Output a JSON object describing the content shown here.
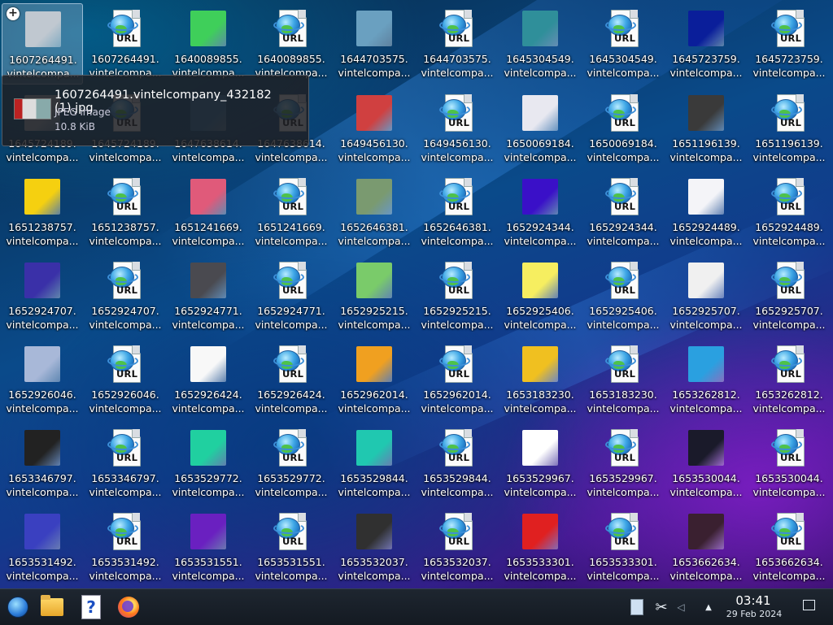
{
  "desktop": {
    "columns_x": [
      0,
      102,
      204,
      306,
      408,
      510,
      612,
      714,
      816,
      918
    ],
    "rows_y": [
      0,
      104,
      207,
      310,
      413,
      516,
      619
    ],
    "icons": [
      {
        "l1": "1607264491.",
        "l2": "vintelcompa...",
        "kind": "thumb",
        "color": "#c0c8d0",
        "sel": true
      },
      {
        "l1": "1607264491.",
        "l2": "vintelcompa...",
        "kind": "url"
      },
      {
        "l1": "1640089855.",
        "l2": "vintelcompa...",
        "kind": "thumb",
        "color": "#3fcf5a"
      },
      {
        "l1": "1640089855.",
        "l2": "vintelcompa...",
        "kind": "url"
      },
      {
        "l1": "1644703575.",
        "l2": "vintelcompa...",
        "kind": "thumb",
        "color": "#6aa0c0"
      },
      {
        "l1": "1644703575.",
        "l2": "vintelcompa...",
        "kind": "url"
      },
      {
        "l1": "1645304549.",
        "l2": "vintelcompa...",
        "kind": "thumb",
        "color": "#2f8f9a"
      },
      {
        "l1": "1645304549.",
        "l2": "vintelcompa...",
        "kind": "url"
      },
      {
        "l1": "1645723759.",
        "l2": "vintelcompa...",
        "kind": "thumb",
        "color": "#0a1e9a"
      },
      {
        "l1": "1645723759.",
        "l2": "vintelcompa...",
        "kind": "url"
      },
      {
        "l1": "1645724189.",
        "l2": "vintelcompa...",
        "kind": "thumb",
        "color": "#b0b8c0"
      },
      {
        "l1": "1645724189.",
        "l2": "vintelcompa...",
        "kind": "url"
      },
      {
        "l1": "1647638614.",
        "l2": "vintelcompa...",
        "kind": "thumb",
        "color": "#2a7ab0"
      },
      {
        "l1": "1647638614.",
        "l2": "vintelcompa...",
        "kind": "url"
      },
      {
        "l1": "1649456130.",
        "l2": "vintelcompa...",
        "kind": "thumb",
        "color": "#d04040"
      },
      {
        "l1": "1649456130.",
        "l2": "vintelcompa...",
        "kind": "url"
      },
      {
        "l1": "1650069184.",
        "l2": "vintelcompa...",
        "kind": "thumb",
        "color": "#e8e8f0"
      },
      {
        "l1": "1650069184.",
        "l2": "vintelcompa...",
        "kind": "url"
      },
      {
        "l1": "1651196139.",
        "l2": "vintelcompa...",
        "kind": "thumb",
        "color": "#3a3a3a"
      },
      {
        "l1": "1651196139.",
        "l2": "vintelcompa...",
        "kind": "url"
      },
      {
        "l1": "1651238757.",
        "l2": "vintelcompa...",
        "kind": "thumb",
        "color": "#f5d010"
      },
      {
        "l1": "1651238757.",
        "l2": "vintelcompa...",
        "kind": "url"
      },
      {
        "l1": "1651241669.",
        "l2": "vintelcompa...",
        "kind": "thumb",
        "color": "#e05a7a"
      },
      {
        "l1": "1651241669.",
        "l2": "vintelcompa...",
        "kind": "url"
      },
      {
        "l1": "1652646381.",
        "l2": "vintelcompa...",
        "kind": "thumb",
        "color": "#7a9a70"
      },
      {
        "l1": "1652646381.",
        "l2": "vintelcompa...",
        "kind": "url"
      },
      {
        "l1": "1652924344.",
        "l2": "vintelcompa...",
        "kind": "thumb",
        "color": "#3a10c8"
      },
      {
        "l1": "1652924344.",
        "l2": "vintelcompa...",
        "kind": "url"
      },
      {
        "l1": "1652924489.",
        "l2": "vintelcompa...",
        "kind": "thumb",
        "color": "#f4f4f8"
      },
      {
        "l1": "1652924489.",
        "l2": "vintelcompa...",
        "kind": "url"
      },
      {
        "l1": "1652924707.",
        "l2": "vintelcompa...",
        "kind": "thumb",
        "color": "#3a30a8"
      },
      {
        "l1": "1652924707.",
        "l2": "vintelcompa...",
        "kind": "url"
      },
      {
        "l1": "1652924771.",
        "l2": "vintelcompa...",
        "kind": "thumb",
        "color": "#4a4a50"
      },
      {
        "l1": "1652924771.",
        "l2": "vintelcompa...",
        "kind": "url"
      },
      {
        "l1": "1652925215.",
        "l2": "vintelcompa...",
        "kind": "thumb",
        "color": "#7acb6a"
      },
      {
        "l1": "1652925215.",
        "l2": "vintelcompa...",
        "kind": "url"
      },
      {
        "l1": "1652925406.",
        "l2": "vintelcompa...",
        "kind": "thumb",
        "color": "#f6ee60"
      },
      {
        "l1": "1652925406.",
        "l2": "vintelcompa...",
        "kind": "url"
      },
      {
        "l1": "1652925707.",
        "l2": "vintelcompa...",
        "kind": "thumb",
        "color": "#f0f0f0"
      },
      {
        "l1": "1652925707.",
        "l2": "vintelcompa...",
        "kind": "url"
      },
      {
        "l1": "1652926046.",
        "l2": "vintelcompa...",
        "kind": "thumb",
        "color": "#a8b8d8"
      },
      {
        "l1": "1652926046.",
        "l2": "vintelcompa...",
        "kind": "url"
      },
      {
        "l1": "1652926424.",
        "l2": "vintelcompa...",
        "kind": "thumb",
        "color": "#f8f8f8"
      },
      {
        "l1": "1652926424.",
        "l2": "vintelcompa...",
        "kind": "url"
      },
      {
        "l1": "1652962014.",
        "l2": "vintelcompa...",
        "kind": "thumb",
        "color": "#f0a020"
      },
      {
        "l1": "1652962014.",
        "l2": "vintelcompa...",
        "kind": "url"
      },
      {
        "l1": "1653183230.",
        "l2": "vintelcompa...",
        "kind": "thumb",
        "color": "#f0c020"
      },
      {
        "l1": "1653183230.",
        "l2": "vintelcompa...",
        "kind": "url"
      },
      {
        "l1": "1653262812.",
        "l2": "vintelcompa...",
        "kind": "thumb",
        "color": "#2aa0e0"
      },
      {
        "l1": "1653262812.",
        "l2": "vintelcompa...",
        "kind": "url"
      },
      {
        "l1": "1653346797.",
        "l2": "vintelcompa...",
        "kind": "thumb",
        "color": "#222222"
      },
      {
        "l1": "1653346797.",
        "l2": "vintelcompa...",
        "kind": "url"
      },
      {
        "l1": "1653529772.",
        "l2": "vintelcompa...",
        "kind": "thumb",
        "color": "#20d0a0"
      },
      {
        "l1": "1653529772.",
        "l2": "vintelcompa...",
        "kind": "url"
      },
      {
        "l1": "1653529844.",
        "l2": "vintelcompa...",
        "kind": "thumb",
        "color": "#20c8b0"
      },
      {
        "l1": "1653529844.",
        "l2": "vintelcompa...",
        "kind": "url"
      },
      {
        "l1": "1653529967.",
        "l2": "vintelcompa...",
        "kind": "thumb",
        "color": "#ffffff"
      },
      {
        "l1": "1653529967.",
        "l2": "vintelcompa...",
        "kind": "url"
      },
      {
        "l1": "1653530044.",
        "l2": "vintelcompa...",
        "kind": "thumb",
        "color": "#1a1a2a"
      },
      {
        "l1": "1653530044.",
        "l2": "vintelcompa...",
        "kind": "url"
      },
      {
        "l1": "1653531492.",
        "l2": "vintelcompa...",
        "kind": "thumb",
        "color": "#3a40c0"
      },
      {
        "l1": "1653531492.",
        "l2": "vintelcompa...",
        "kind": "url"
      },
      {
        "l1": "1653531551.",
        "l2": "vintelcompa...",
        "kind": "thumb",
        "color": "#6a20c0"
      },
      {
        "l1": "1653531551.",
        "l2": "vintelcompa...",
        "kind": "url"
      },
      {
        "l1": "1653532037.",
        "l2": "vintelcompa...",
        "kind": "thumb",
        "color": "#303030"
      },
      {
        "l1": "1653532037.",
        "l2": "vintelcompa...",
        "kind": "url"
      },
      {
        "l1": "1653533301.",
        "l2": "vintelcompa...",
        "kind": "thumb",
        "color": "#e02020"
      },
      {
        "l1": "1653533301.",
        "l2": "vintelcompa...",
        "kind": "url"
      },
      {
        "l1": "1653662634.",
        "l2": "vintelcompa...",
        "kind": "thumb",
        "color": "#3a2030"
      },
      {
        "l1": "1653662634.",
        "l2": "vintelcompa...",
        "kind": "url"
      }
    ],
    "url_badge_text": "URL"
  },
  "tooltip": {
    "filename": "1607264491.vintelcompany_432182 (1).jpg",
    "type": "JPEG image",
    "size": "10.8 KiB"
  },
  "taskbar": {
    "apps": [
      {
        "name": "start-menu-icon"
      },
      {
        "name": "file-manager-icon"
      },
      {
        "name": "help-icon",
        "glyph": "?"
      },
      {
        "name": "firefox-icon"
      }
    ],
    "tray": {
      "scissors_glyph": "✂",
      "volume_glyph": "◁",
      "expand_glyph": "▲"
    },
    "clock": {
      "time": "03:41",
      "date": "29 Feb 2024"
    }
  }
}
